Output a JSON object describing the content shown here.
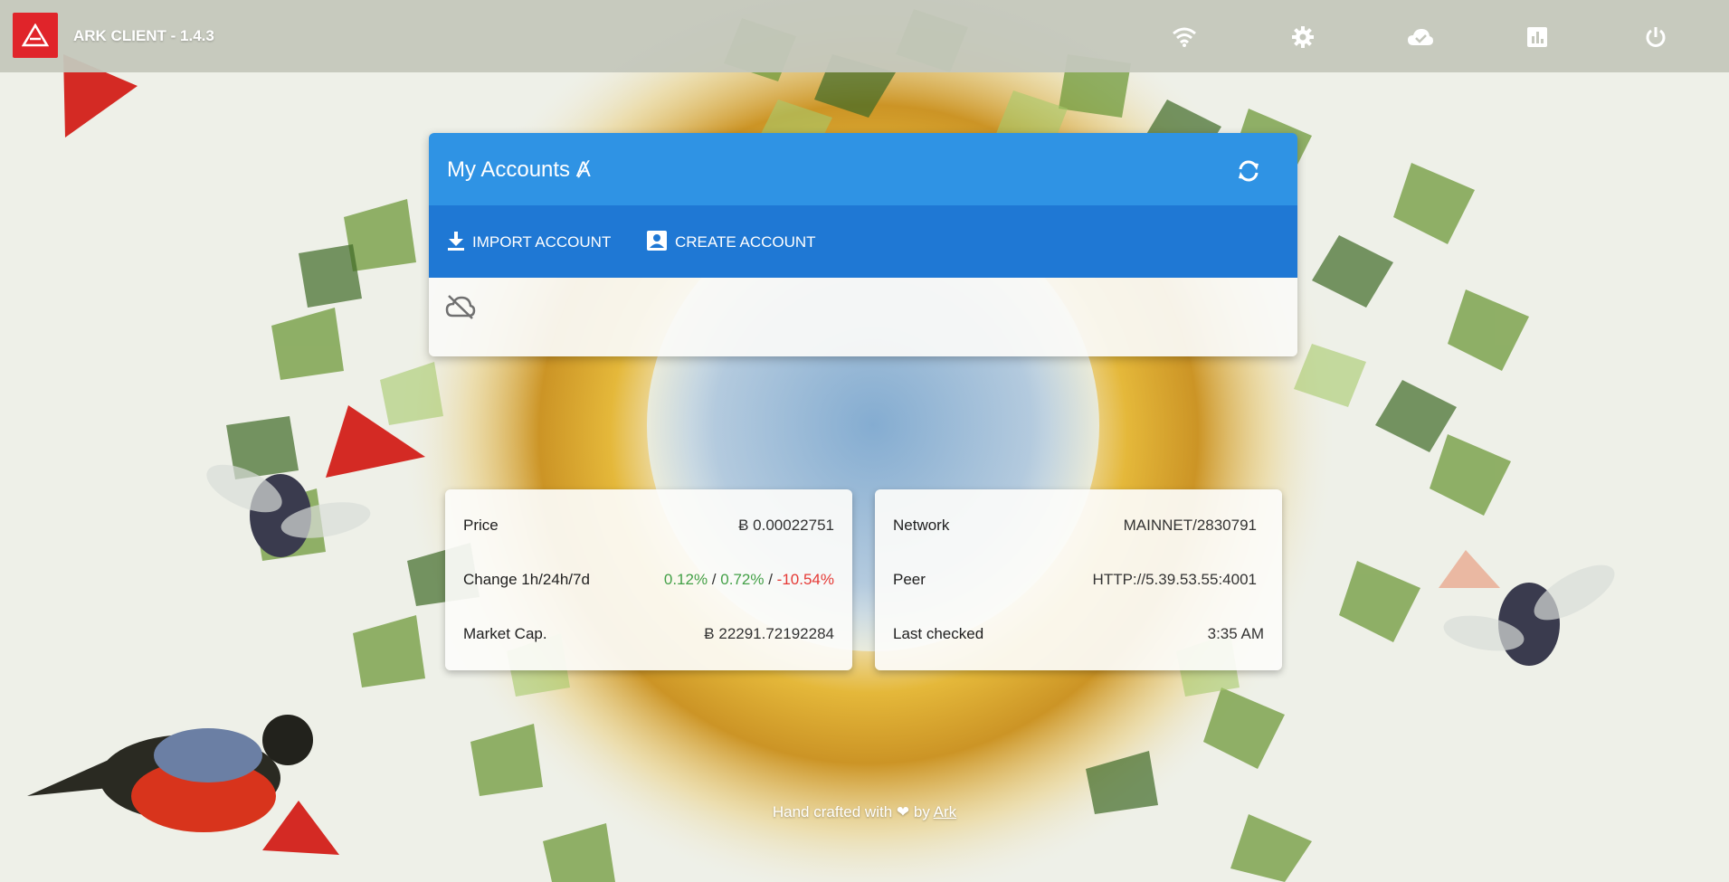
{
  "app": {
    "title": "ARK CLIENT - 1.4.3"
  },
  "topbar": {
    "icons": [
      "ark-logo-icon",
      "wifi-icon",
      "gear-icon",
      "cloud-done-icon",
      "chart-icon",
      "power-icon"
    ]
  },
  "accounts": {
    "title": "My Accounts Ⱥ",
    "import_label": "IMPORT ACCOUNT",
    "create_label": "CREATE ACCOUNT"
  },
  "market": {
    "price_label": "Price",
    "price_value": "Ƀ 0.00022751",
    "change_label": "Change 1h/24h/7d",
    "change_1h": "0.12%",
    "change_24h": "0.72%",
    "change_7d": "-10.54%",
    "change_sep": "/",
    "cap_label": "Market Cap.",
    "cap_value": "Ƀ 22291.72192284"
  },
  "network": {
    "network_label": "Network",
    "network_value": "MAINNET/2830791",
    "peer_label": "Peer",
    "peer_value": "HTTP://5.39.53.55:4001",
    "checked_label": "Last checked",
    "checked_value": "3:35 AM"
  },
  "footer": {
    "prefix": "Hand crafted with",
    "by": "by",
    "link": "Ark"
  },
  "colors": {
    "brand_red": "#e0242a",
    "header_blue": "#2f93e4",
    "toolbar_blue": "#1f78d4",
    "positive": "#43a047",
    "negative": "#e53935"
  }
}
